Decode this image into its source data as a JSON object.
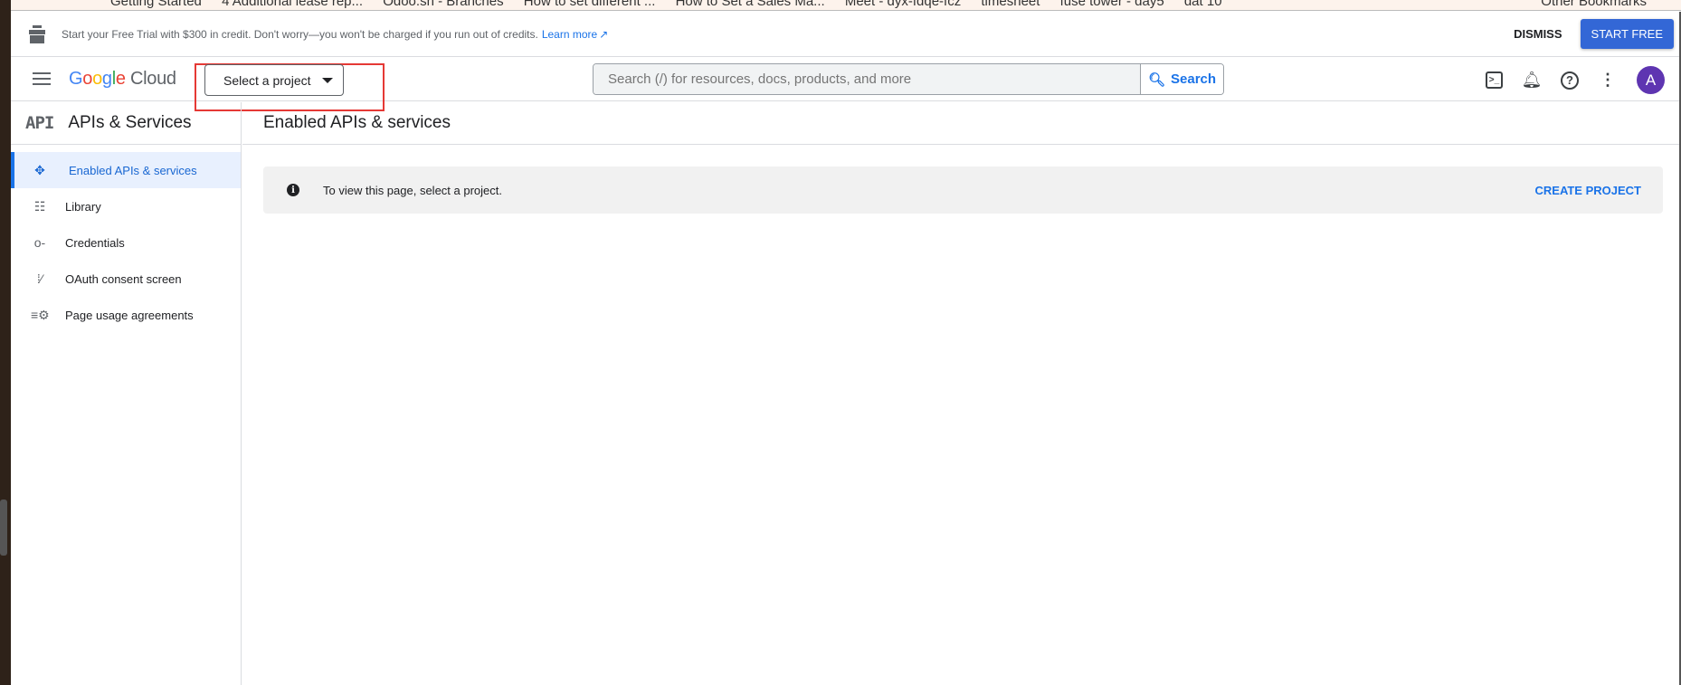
{
  "bookmarks": {
    "items": [
      "Getting Started",
      "4 Additional lease rep...",
      "Odoo.sh - Branches",
      "How to set different ...",
      "How to Set a Sales Ma...",
      "Meet - dyx-fdqe-fcz",
      "timesheet",
      "fuse tower - day5",
      "dat 10"
    ],
    "other": "Other Bookmarks"
  },
  "banner": {
    "text": "Start your Free Trial with $300 in credit. Don't worry—you won't be charged if you run out of credits.",
    "learn_more": "Learn more",
    "dismiss": "DISMISS",
    "start_free": "START FREE"
  },
  "header": {
    "logo": "Google Cloud",
    "project_selector": "Select a project",
    "search_placeholder": "Search (/) for resources, docs, products, and more",
    "search_button": "Search",
    "avatar": "A"
  },
  "sidebar": {
    "icon": "API",
    "title": "APIs & Services",
    "items": [
      {
        "label": "Enabled APIs & services",
        "icon": "enabled-apis-icon",
        "active": true
      },
      {
        "label": "Library",
        "icon": "library-icon"
      },
      {
        "label": "Credentials",
        "icon": "key-icon"
      },
      {
        "label": "OAuth consent screen",
        "icon": "oauth-icon"
      },
      {
        "label": "Page usage agreements",
        "icon": "settings-list-icon"
      }
    ]
  },
  "main": {
    "title": "Enabled APIs & services",
    "notice": "To view this page, select a project.",
    "create_project": "CREATE PROJECT"
  },
  "colors": {
    "accent": "#1a73e8",
    "start_button": "#3367d6",
    "highlight_box": "#e53935",
    "avatar": "#5e35b1"
  }
}
